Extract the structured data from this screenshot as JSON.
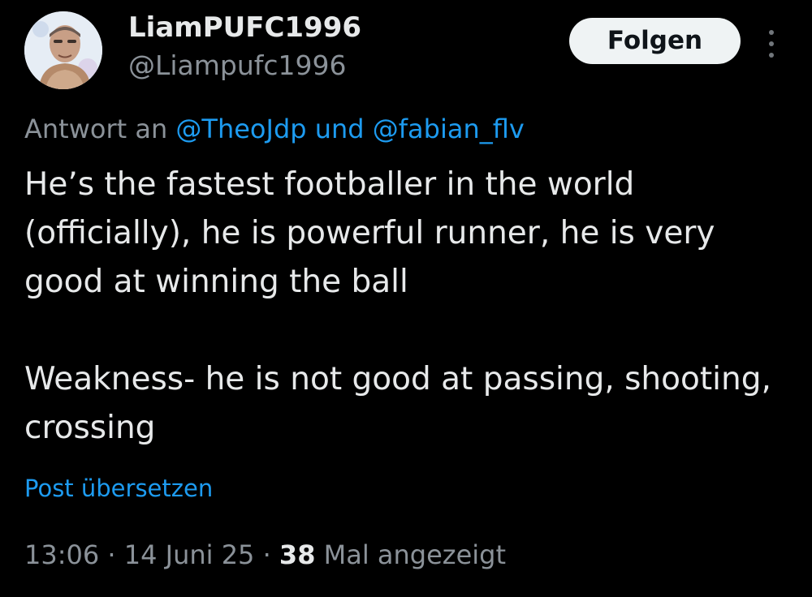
{
  "author": {
    "display_name": "LiamPUFC1996",
    "handle": "@Liampufc1996"
  },
  "actions": {
    "follow_label": "Folgen",
    "more_icon": "more-vertical-icon"
  },
  "reply": {
    "prefix": "Antwort an",
    "mention_1": "@TheoJdp",
    "conjunction": "und",
    "mention_2": "@fabian_flv"
  },
  "post": {
    "paragraph_1": "He’s the fastest footballer in the world (officially), he is powerful runner, he is very good at winning the ball",
    "paragraph_2": "Weakness- he is not good at passing, shooting, crossing",
    "translate_label": "Post übersetzen"
  },
  "meta": {
    "time": "13:06",
    "date": "14 Juni 25",
    "separator": "·",
    "views_count": "38",
    "views_label": "Mal angezeigt"
  },
  "colors": {
    "background": "#000000",
    "text_primary": "#e7e9ea",
    "text_secondary": "#8b9299",
    "accent": "#1d9bf0",
    "button_bg": "#eff3f4"
  }
}
